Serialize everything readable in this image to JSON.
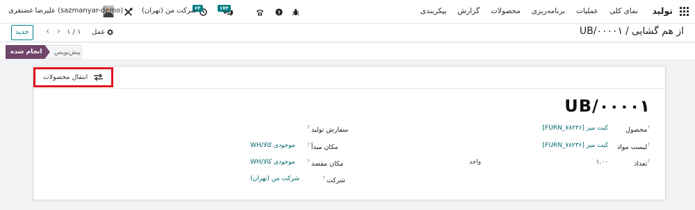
{
  "navbar": {
    "apps_icon": "grid-icon",
    "brand": "تولید",
    "menu": [
      "نمای کلی",
      "عملیات",
      "برنامه‌ریزی",
      "محصولات",
      "گزارش",
      "پیکربندی"
    ],
    "bug_icon": "bug-icon",
    "help_icon": "question-circle-icon",
    "phone_icon": "phone-icon",
    "messages_badge": "۱۷۴",
    "activity_badge": "۶۳",
    "company": "شرکت من (تهران)",
    "tools_icon": "tools-icon",
    "user_name": "علیرضا غضنفری (sazmanyar-demo)"
  },
  "control": {
    "breadcrumb_parent": "از هم گشایی",
    "separator": "/",
    "record_name": "UB/۰۰۰۰۱",
    "action_label": "عمل",
    "pager_value": "۱ / ۱",
    "new_button": "جدید"
  },
  "status": {
    "done": "انجام شده",
    "draft": "پیش‌نویس"
  },
  "sheet": {
    "smart_button": "انتقال محصولات",
    "reference": "UB/۰۰۰۰۱",
    "product_label": "محصول",
    "product_value": "[FURN_۷۸۲۳۶] کیت میز",
    "bom_label": "لیست مواد",
    "bom_value": "[FURN_۷۸۲۳۶] کیت میز",
    "qty_label": "تعداد",
    "qty_value": "۱.۰۰",
    "qty_unit": "واحد",
    "mo_label": "سفارش تولید",
    "src_label": "مکان مبدأ",
    "src_value": "WH/موجودی کالا",
    "dest_label": "مکان مقصد",
    "dest_value": "WH/موجودی کالا",
    "company_label": "شرکت",
    "company_value": "شرکت من (تهران)",
    "help_mark": "?"
  },
  "colors": {
    "primary": "#017e84",
    "stage_done": "#71466b",
    "highlight": "#e0141e",
    "messages_badge": "#017e84",
    "activity_badge": "#017e84"
  }
}
